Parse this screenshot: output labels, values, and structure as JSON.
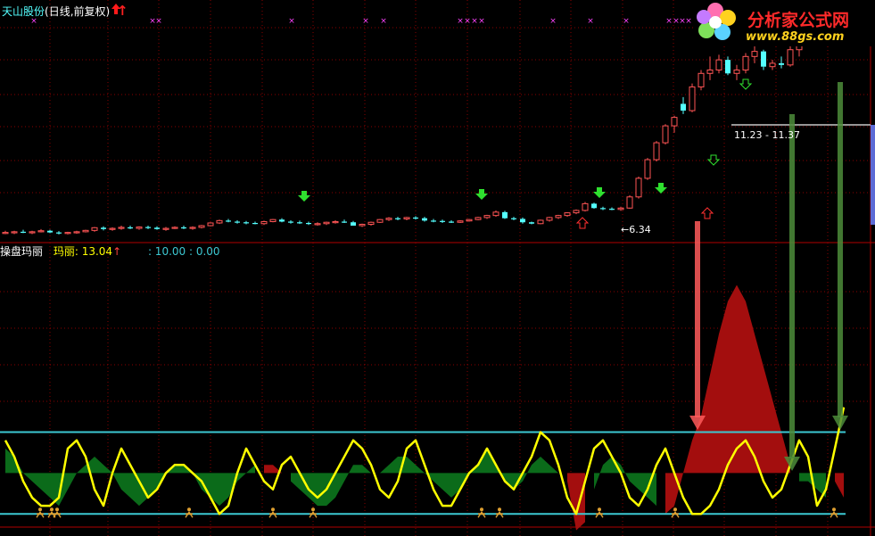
{
  "header": {
    "stock_name": "天山股份",
    "period_label": "(日线,前复权)",
    "up_arrow": "↑"
  },
  "indicator": {
    "name": "操盘玛丽",
    "value_label": "玛丽: 13.04",
    "up_arrow": "↑",
    "levels_text": ": 10.00 : 0.00"
  },
  "annotations": {
    "low_price": "6.34",
    "low_arrow": "←",
    "range_label": "11.23 - 11.37"
  },
  "watermark": {
    "title": "分析家公式网",
    "url": "www.88gs.com"
  },
  "colors": {
    "up": "#ff5555",
    "down": "#54ffff",
    "yellow": "#ffff00",
    "green_fill": "#0b6b1a",
    "red_fill": "#a30e0e",
    "cyan_line": "#3cc8d2",
    "magenta": "#ff44ff",
    "grid": "#8a0000"
  },
  "chart_data": {
    "type": "candlestick",
    "price_ylim": [
      5.8,
      12.6
    ],
    "candles": [
      {
        "o": 6.1,
        "h": 6.15,
        "l": 6.05,
        "c": 6.1
      },
      {
        "o": 6.1,
        "h": 6.15,
        "l": 6.05,
        "c": 6.12
      },
      {
        "o": 6.12,
        "h": 6.18,
        "l": 6.08,
        "c": 6.1
      },
      {
        "o": 6.1,
        "h": 6.15,
        "l": 6.05,
        "c": 6.12
      },
      {
        "o": 6.12,
        "h": 6.2,
        "l": 6.1,
        "c": 6.15
      },
      {
        "o": 6.15,
        "h": 6.18,
        "l": 6.08,
        "c": 6.1
      },
      {
        "o": 6.1,
        "h": 6.14,
        "l": 6.04,
        "c": 6.08
      },
      {
        "o": 6.08,
        "h": 6.12,
        "l": 6.04,
        "c": 6.1
      },
      {
        "o": 6.1,
        "h": 6.15,
        "l": 6.06,
        "c": 6.12
      },
      {
        "o": 6.12,
        "h": 6.18,
        "l": 6.1,
        "c": 6.16
      },
      {
        "o": 6.16,
        "h": 6.26,
        "l": 6.12,
        "c": 6.24
      },
      {
        "o": 6.24,
        "h": 6.28,
        "l": 6.16,
        "c": 6.2
      },
      {
        "o": 6.2,
        "h": 6.25,
        "l": 6.15,
        "c": 6.22
      },
      {
        "o": 6.22,
        "h": 6.3,
        "l": 6.18,
        "c": 6.25
      },
      {
        "o": 6.25,
        "h": 6.3,
        "l": 6.2,
        "c": 6.22
      },
      {
        "o": 6.22,
        "h": 6.28,
        "l": 6.18,
        "c": 6.26
      },
      {
        "o": 6.26,
        "h": 6.3,
        "l": 6.2,
        "c": 6.24
      },
      {
        "o": 6.24,
        "h": 6.28,
        "l": 6.18,
        "c": 6.2
      },
      {
        "o": 6.2,
        "h": 6.26,
        "l": 6.15,
        "c": 6.22
      },
      {
        "o": 6.22,
        "h": 6.28,
        "l": 6.2,
        "c": 6.25
      },
      {
        "o": 6.25,
        "h": 6.3,
        "l": 6.2,
        "c": 6.22
      },
      {
        "o": 6.22,
        "h": 6.28,
        "l": 6.18,
        "c": 6.25
      },
      {
        "o": 6.25,
        "h": 6.32,
        "l": 6.22,
        "c": 6.3
      },
      {
        "o": 6.3,
        "h": 6.4,
        "l": 6.28,
        "c": 6.38
      },
      {
        "o": 6.38,
        "h": 6.48,
        "l": 6.35,
        "c": 6.45
      },
      {
        "o": 6.45,
        "h": 6.5,
        "l": 6.4,
        "c": 6.42
      },
      {
        "o": 6.42,
        "h": 6.46,
        "l": 6.36,
        "c": 6.4
      },
      {
        "o": 6.4,
        "h": 6.44,
        "l": 6.34,
        "c": 6.38
      },
      {
        "o": 6.38,
        "h": 6.42,
        "l": 6.34,
        "c": 6.36
      },
      {
        "o": 6.36,
        "h": 6.45,
        "l": 6.32,
        "c": 6.42
      },
      {
        "o": 6.42,
        "h": 6.5,
        "l": 6.4,
        "c": 6.48
      },
      {
        "o": 6.48,
        "h": 6.52,
        "l": 6.4,
        "c": 6.42
      },
      {
        "o": 6.42,
        "h": 6.46,
        "l": 6.36,
        "c": 6.4
      },
      {
        "o": 6.4,
        "h": 6.45,
        "l": 6.35,
        "c": 6.38
      },
      {
        "o": 6.38,
        "h": 6.42,
        "l": 6.32,
        "c": 6.35
      },
      {
        "o": 6.35,
        "h": 6.4,
        "l": 6.3,
        "c": 6.36
      },
      {
        "o": 6.36,
        "h": 6.42,
        "l": 6.32,
        "c": 6.4
      },
      {
        "o": 6.4,
        "h": 6.46,
        "l": 6.36,
        "c": 6.42
      },
      {
        "o": 6.42,
        "h": 6.48,
        "l": 6.38,
        "c": 6.4
      },
      {
        "o": 6.4,
        "h": 6.44,
        "l": 6.3,
        "c": 6.3
      },
      {
        "o": 6.3,
        "h": 6.36,
        "l": 6.26,
        "c": 6.34
      },
      {
        "o": 6.34,
        "h": 6.42,
        "l": 6.3,
        "c": 6.4
      },
      {
        "o": 6.4,
        "h": 6.5,
        "l": 6.38,
        "c": 6.48
      },
      {
        "o": 6.48,
        "h": 6.55,
        "l": 6.44,
        "c": 6.52
      },
      {
        "o": 6.52,
        "h": 6.56,
        "l": 6.46,
        "c": 6.5
      },
      {
        "o": 6.5,
        "h": 6.56,
        "l": 6.46,
        "c": 6.54
      },
      {
        "o": 6.54,
        "h": 6.58,
        "l": 6.48,
        "c": 6.52
      },
      {
        "o": 6.52,
        "h": 6.56,
        "l": 6.42,
        "c": 6.45
      },
      {
        "o": 6.45,
        "h": 6.5,
        "l": 6.4,
        "c": 6.44
      },
      {
        "o": 6.44,
        "h": 6.48,
        "l": 6.38,
        "c": 6.42
      },
      {
        "o": 6.42,
        "h": 6.46,
        "l": 6.38,
        "c": 6.4
      },
      {
        "o": 6.4,
        "h": 6.46,
        "l": 6.38,
        "c": 6.44
      },
      {
        "o": 6.44,
        "h": 6.5,
        "l": 6.42,
        "c": 6.48
      },
      {
        "o": 6.48,
        "h": 6.56,
        "l": 6.46,
        "c": 6.54
      },
      {
        "o": 6.54,
        "h": 6.62,
        "l": 6.5,
        "c": 6.6
      },
      {
        "o": 6.6,
        "h": 6.75,
        "l": 6.56,
        "c": 6.7
      },
      {
        "o": 6.7,
        "h": 6.74,
        "l": 6.5,
        "c": 6.52
      },
      {
        "o": 6.52,
        "h": 6.56,
        "l": 6.46,
        "c": 6.5
      },
      {
        "o": 6.5,
        "h": 6.54,
        "l": 6.36,
        "c": 6.4
      },
      {
        "o": 6.4,
        "h": 6.42,
        "l": 6.34,
        "c": 6.36
      },
      {
        "o": 6.36,
        "h": 6.48,
        "l": 6.34,
        "c": 6.46
      },
      {
        "o": 6.46,
        "h": 6.56,
        "l": 6.42,
        "c": 6.54
      },
      {
        "o": 6.54,
        "h": 6.62,
        "l": 6.5,
        "c": 6.6
      },
      {
        "o": 6.6,
        "h": 6.7,
        "l": 6.56,
        "c": 6.68
      },
      {
        "o": 6.68,
        "h": 6.78,
        "l": 6.64,
        "c": 6.75
      },
      {
        "o": 6.75,
        "h": 7.0,
        "l": 6.72,
        "c": 6.95
      },
      {
        "o": 6.95,
        "h": 6.98,
        "l": 6.8,
        "c": 6.82
      },
      {
        "o": 6.82,
        "h": 6.86,
        "l": 6.76,
        "c": 6.8
      },
      {
        "o": 6.8,
        "h": 6.84,
        "l": 6.76,
        "c": 6.78
      },
      {
        "o": 6.78,
        "h": 6.86,
        "l": 6.74,
        "c": 6.82
      },
      {
        "o": 6.82,
        "h": 7.2,
        "l": 6.8,
        "c": 7.15
      },
      {
        "o": 7.15,
        "h": 7.75,
        "l": 7.1,
        "c": 7.7
      },
      {
        "o": 7.7,
        "h": 8.3,
        "l": 7.65,
        "c": 8.25
      },
      {
        "o": 8.25,
        "h": 8.8,
        "l": 8.2,
        "c": 8.75
      },
      {
        "o": 8.75,
        "h": 9.3,
        "l": 8.7,
        "c": 9.25
      },
      {
        "o": 9.25,
        "h": 9.55,
        "l": 9.05,
        "c": 9.5
      },
      {
        "o": 9.9,
        "h": 10.1,
        "l": 9.6,
        "c": 9.7
      },
      {
        "o": 9.7,
        "h": 10.5,
        "l": 9.65,
        "c": 10.4
      },
      {
        "o": 10.4,
        "h": 10.9,
        "l": 10.3,
        "c": 10.8
      },
      {
        "o": 10.8,
        "h": 11.3,
        "l": 10.6,
        "c": 10.9
      },
      {
        "o": 10.9,
        "h": 11.35,
        "l": 10.8,
        "c": 11.2
      },
      {
        "o": 11.2,
        "h": 11.3,
        "l": 10.75,
        "c": 10.8
      },
      {
        "o": 10.8,
        "h": 11.05,
        "l": 10.6,
        "c": 10.9
      },
      {
        "o": 10.9,
        "h": 11.4,
        "l": 10.8,
        "c": 11.3
      },
      {
        "o": 11.3,
        "h": 11.6,
        "l": 11.1,
        "c": 11.45
      },
      {
        "o": 11.45,
        "h": 11.5,
        "l": 10.9,
        "c": 11.0
      },
      {
        "o": 11.0,
        "h": 11.2,
        "l": 10.9,
        "c": 11.1
      },
      {
        "o": 11.1,
        "h": 11.3,
        "l": 10.95,
        "c": 11.05
      },
      {
        "o": 11.05,
        "h": 11.6,
        "l": 11.0,
        "c": 11.5
      },
      {
        "o": 11.5,
        "h": 12.2,
        "l": 11.3,
        "c": 12.1
      },
      {
        "o": 12.1,
        "h": 12.5,
        "l": 11.95,
        "c": 12.3
      },
      {
        "o": 12.4,
        "h": 12.6,
        "l": 11.9,
        "c": 11.95
      }
    ],
    "indicator_ylim": [
      -1.5,
      31
    ],
    "yellow_line": [
      9,
      7,
      4,
      2,
      1,
      1,
      2,
      8,
      9,
      7,
      3,
      1,
      5,
      8,
      6,
      4,
      2,
      3,
      5,
      6,
      6,
      5,
      4,
      2,
      0,
      1,
      5,
      8,
      6,
      4,
      3,
      6,
      7,
      5,
      3,
      2,
      3,
      5,
      7,
      9,
      8,
      6,
      3,
      2,
      4,
      8,
      9,
      6,
      3,
      1,
      1,
      3,
      5,
      6,
      8,
      6,
      4,
      3,
      5,
      7,
      10,
      9,
      6,
      2,
      0,
      4,
      8,
      9,
      7,
      5,
      2,
      1,
      3,
      6,
      8,
      5,
      2,
      0,
      0,
      1,
      3,
      6,
      8,
      9,
      7,
      4,
      2,
      3,
      6,
      9,
      7,
      1,
      3,
      8,
      13.04
    ],
    "osc_area": [
      8,
      7,
      5,
      4,
      3,
      2,
      1,
      3,
      5,
      6,
      7,
      6,
      5,
      3,
      2,
      1,
      2,
      3,
      5,
      6,
      6,
      5,
      3,
      2,
      1,
      2,
      4,
      5,
      6,
      6,
      6,
      5,
      4,
      3,
      2,
      1,
      1,
      2,
      4,
      6,
      6,
      5,
      5,
      6,
      7,
      7,
      6,
      5,
      4,
      3,
      2,
      3,
      5,
      6,
      8,
      6,
      4,
      3,
      4,
      6,
      7,
      6,
      5,
      4,
      -2,
      -1,
      3,
      6,
      7,
      6,
      4,
      3,
      2,
      1,
      0,
      1,
      5,
      9,
      12,
      17,
      22,
      26,
      28,
      26,
      22,
      18,
      14,
      10,
      6,
      4,
      4,
      3,
      2,
      4,
      2
    ],
    "upper_level": 10.0,
    "lower_level": 0.0
  }
}
